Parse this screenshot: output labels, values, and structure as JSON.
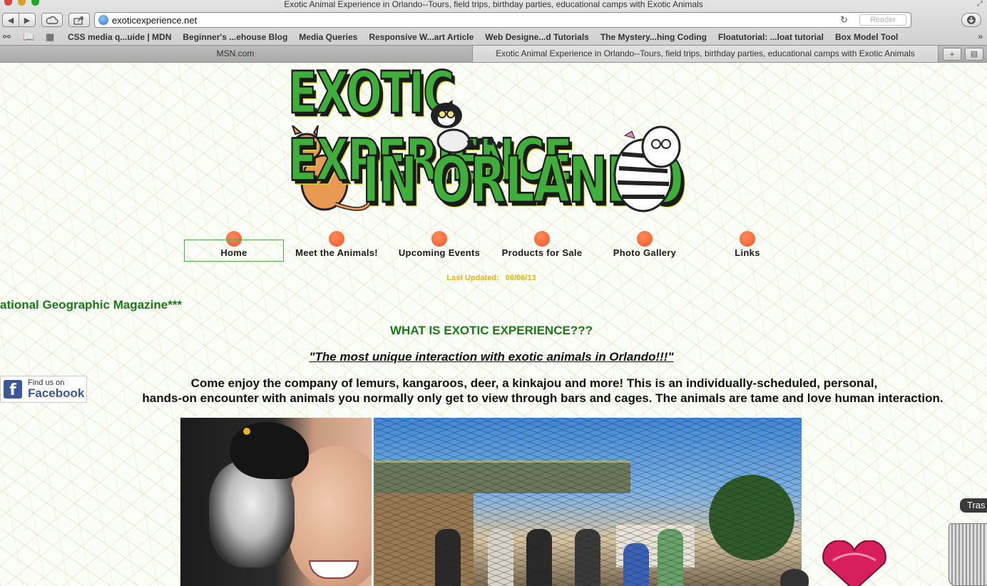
{
  "window": {
    "title": "Exotic Animal Experience in Orlando--Tours, field trips, birthday parties, educational camps with Exotic Animals"
  },
  "toolbar": {
    "back_glyph": "◀",
    "forward_glyph": "▶",
    "icloud_icon": "cloud-icon",
    "share_icon": "share-icon",
    "download_icon": "download-icon"
  },
  "address_bar": {
    "url": "exoticexperience.net",
    "reader_label": "Reader",
    "reload_glyph": "↻"
  },
  "bookmarks": {
    "items": [
      "CSS media q...uide | MDN",
      "Beginner's ...ehouse Blog",
      "Media Queries",
      "Responsive W...art Article",
      "Web Designe...d Tutorials",
      "The Mystery...hing Coding",
      "Floatutorial: ...loat tutorial",
      "Box Model Tool"
    ],
    "more_glyph": "»"
  },
  "tabs": [
    {
      "label": "MSN.com",
      "active": false
    },
    {
      "label": "Exotic Animal Experience in Orlando--Tours, field trips, birthday parties, educational camps with Exotic Animals",
      "active": true
    }
  ],
  "page": {
    "logo": {
      "line1": "EXOTIC EXPERIENCE",
      "line2": "IN ORLANDO"
    },
    "nav": [
      {
        "label": "Home",
        "selected": true
      },
      {
        "label": "Meet the Animals!",
        "selected": false
      },
      {
        "label": "Upcoming Events",
        "selected": false
      },
      {
        "label": "Products for Sale",
        "selected": false
      },
      {
        "label": "Photo Gallery",
        "selected": false
      },
      {
        "label": "Links",
        "selected": false
      }
    ],
    "last_updated_label": "Last Updated:",
    "last_updated_value": "06/06/13",
    "marquee": "ational Geographic Magazine***",
    "what_is_heading": "WHAT IS EXOTIC EXPERIENCE???",
    "tagline": "\"The most unique interaction with exotic animals in Orlando!!!\"",
    "facebook": {
      "find_us": "Find us on",
      "name": "Facebook"
    },
    "intro_line1": "Come enjoy the company of lemurs, kangaroos, deer, a kinkajou and more!  This is an individually-scheduled, personal,",
    "intro_line2": "hands-on encounter with animals you normally only get to view through bars and cages.  The animals are tame and love human interaction."
  },
  "desktop": {
    "trash_tooltip": "Tras"
  },
  "colors": {
    "nav_dot": "#f2572a",
    "heading_green": "#1a7a1a",
    "updated_gold": "#e8b21a",
    "facebook_blue": "#3b5998"
  }
}
